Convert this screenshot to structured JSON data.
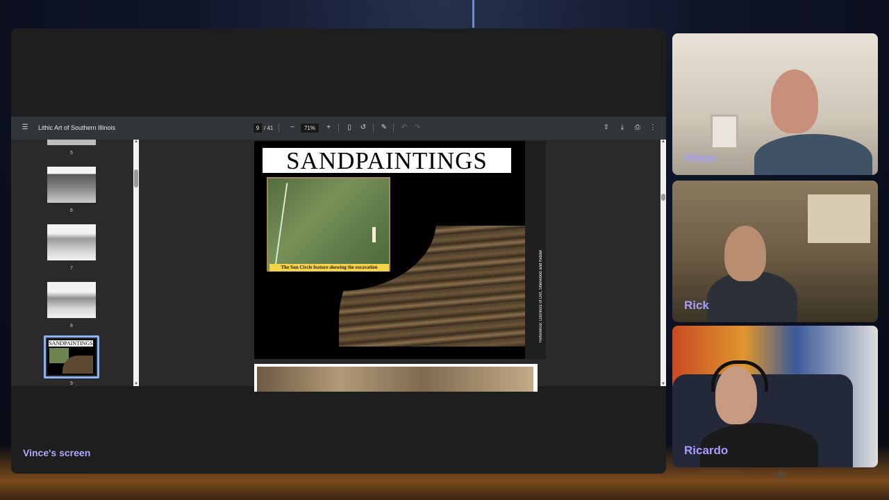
{
  "pdf_viewer": {
    "document_title": "Lithic Art of Southern Illinois",
    "current_page": "9",
    "total_pages": "/ 41",
    "zoom": "71%",
    "icons": {
      "menu": "hamburger-menu-icon",
      "zoom_out": "minus-icon",
      "zoom_in": "plus-icon",
      "fit_page": "fit-page-icon",
      "rotate": "rotate-icon",
      "annotate": "annotate-icon",
      "undo": "undo-icon",
      "redo": "redo-icon",
      "save_drive": "drive-upload-icon",
      "download": "download-icon",
      "print": "print-icon",
      "more": "more-vertical-icon"
    }
  },
  "thumbnails": [
    {
      "page": "5"
    },
    {
      "page": "6"
    },
    {
      "page": "7"
    },
    {
      "page": "8"
    },
    {
      "page": "9",
      "selected": true,
      "title": "SANDPAINTINGS"
    }
  ],
  "page_content": {
    "title": "SANDPAINTINGS",
    "photo_caption": "The Sun Circle feature showing the excavation",
    "reference": "Reference: DaVincis of Dirt, Sherwood and Kidder"
  },
  "screen_share_label": "Vince's screen",
  "participants": [
    {
      "name": "Vince"
    },
    {
      "name": "Rick"
    },
    {
      "name": "Ricardo"
    }
  ],
  "accent_color": "#a79dff"
}
